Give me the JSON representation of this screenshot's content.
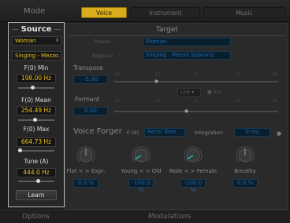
{
  "top": {
    "mode_label": "Mode",
    "tabs": [
      {
        "label": "Voice",
        "active": true
      },
      {
        "label": "Instrument",
        "active": false
      },
      {
        "label": "Music",
        "active": false
      }
    ]
  },
  "source": {
    "title": "Source",
    "voice_type": "Woman",
    "register": "Singing - Mezzo...",
    "params": [
      {
        "label": "F(0) Min",
        "value": "198.00 Hz",
        "level": 0.4
      },
      {
        "label": "F(0) Mean",
        "value": "254.49 Hz",
        "level": 0.45
      },
      {
        "label": "F(0) Max",
        "value": "664.73 Hz",
        "level": 0.05
      },
      {
        "label": "Tune (A)",
        "value": "444.0 Hz",
        "level": 0.55
      }
    ],
    "learn_label": "Learn"
  },
  "target": {
    "title": "Target",
    "preset_label": "Preset",
    "preset_value": "Woman",
    "register_label": "Register",
    "register_value": "Singing - Mezzo Soprano",
    "transpose_label": "Transpose",
    "transpose_value": "-5.00",
    "formant_label": "Formant",
    "formant_value": "0.00",
    "link_label": "Link",
    "inv_label": "Inv.",
    "scale_ticks": [
      "24",
      "12",
      "0",
      "12",
      "24"
    ]
  },
  "voice_forger": {
    "title": "Voice Forger",
    "f0_label": "F (0)",
    "f0_value": "Retro Tone",
    "integration_label": "Integration",
    "integration_value": "0 ms",
    "knobs": [
      {
        "label": "Flat < > Expr.",
        "value": "0.0 %",
        "level": 0.5,
        "accent": "#777777"
      },
      {
        "label": "Young < > Old",
        "value": "-100.0 %",
        "level": 0.05,
        "accent": "#1fb3b0"
      },
      {
        "label": "Male < > Female",
        "value": "-100.0 %",
        "level": 0.05,
        "accent": "#1fb3b0"
      },
      {
        "label": "Breathy",
        "value": "0.0 %",
        "level": 0.5,
        "accent": "#777777"
      }
    ]
  },
  "bottom": {
    "options_label": "Options",
    "modulations_label": "Modulations"
  }
}
